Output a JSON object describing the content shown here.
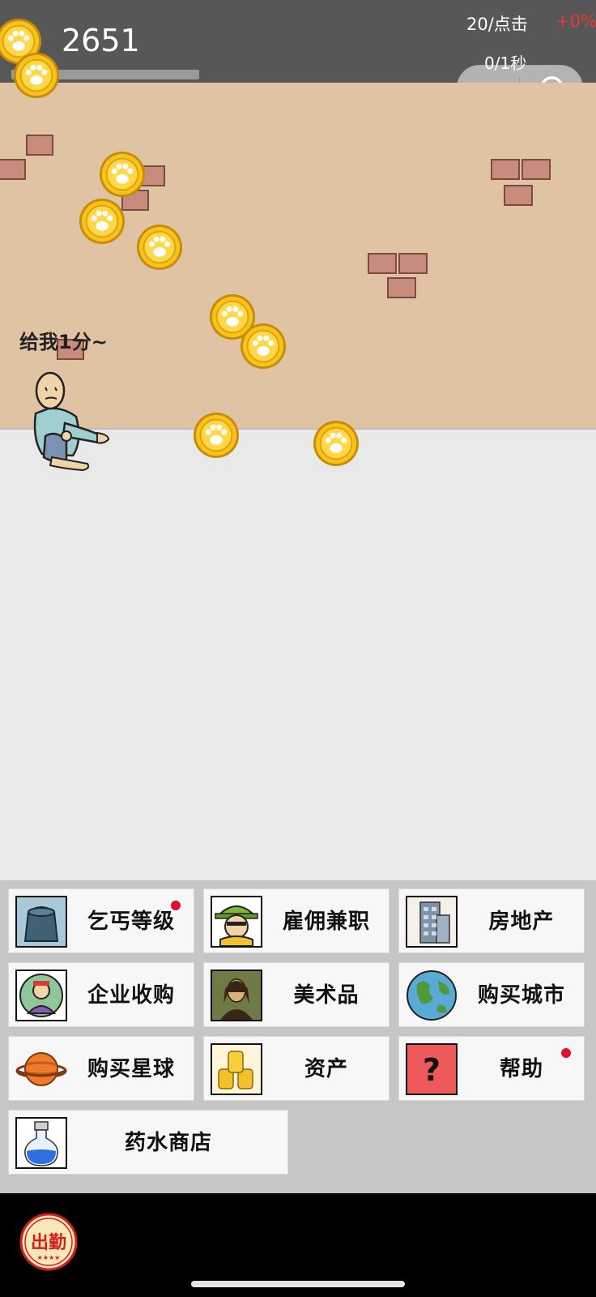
{
  "header": {
    "score": "2651",
    "per_click": "20/点击",
    "percent": "+0%",
    "per_second": "0/1秒",
    "progress": 1.0
  },
  "scene": {
    "speech": "给我1分~"
  },
  "menu": {
    "items": [
      {
        "label": "乞丐等级",
        "icon": "bag-icon",
        "notify": true
      },
      {
        "label": "雇佣兼职",
        "icon": "worker-icon",
        "notify": false
      },
      {
        "label": "房地产",
        "icon": "building-icon",
        "notify": false
      },
      {
        "label": "企业收购",
        "icon": "businessman-icon",
        "notify": false
      },
      {
        "label": "美术品",
        "icon": "painting-icon",
        "notify": false
      },
      {
        "label": "购买城市",
        "icon": "globe-icon",
        "notify": false
      },
      {
        "label": "购买星球",
        "icon": "planet-icon",
        "notify": false
      },
      {
        "label": "资产",
        "icon": "gold-stack-icon",
        "notify": false
      },
      {
        "label": "帮助",
        "icon": "question-icon",
        "notify": true
      },
      {
        "label": "药水商店",
        "icon": "potion-icon",
        "notify": false
      }
    ]
  },
  "bottom": {
    "work_button": "出勤"
  },
  "colors": {
    "topbar": "#575757",
    "wall": "#dfc3a3",
    "brick": "#c78c7b",
    "coin": "#f6c21c",
    "notify": "#e0102a",
    "percent": "#e53935"
  }
}
